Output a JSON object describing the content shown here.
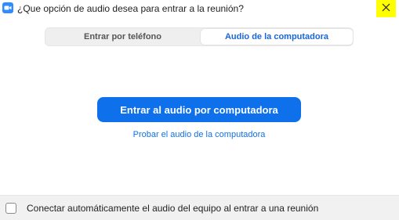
{
  "window": {
    "title": "¿Que opción de audio desea para entrar a la reunión?",
    "app_icon": "video-camera-icon",
    "close_icon": "close-icon",
    "close_highlight_color": "#ffff00"
  },
  "tabs": [
    {
      "label": "Entrar por teléfono",
      "selected": false
    },
    {
      "label": "Audio de la computadora",
      "selected": true
    }
  ],
  "main": {
    "join_button_label": "Entrar al audio por computadora",
    "test_link_label": "Probar el audio de la computadora",
    "accent_color": "#0e71eb"
  },
  "footer": {
    "auto_connect_label": "Conectar automáticamente el audio del equipo al entrar a una reunión",
    "auto_connect_checked": false
  }
}
